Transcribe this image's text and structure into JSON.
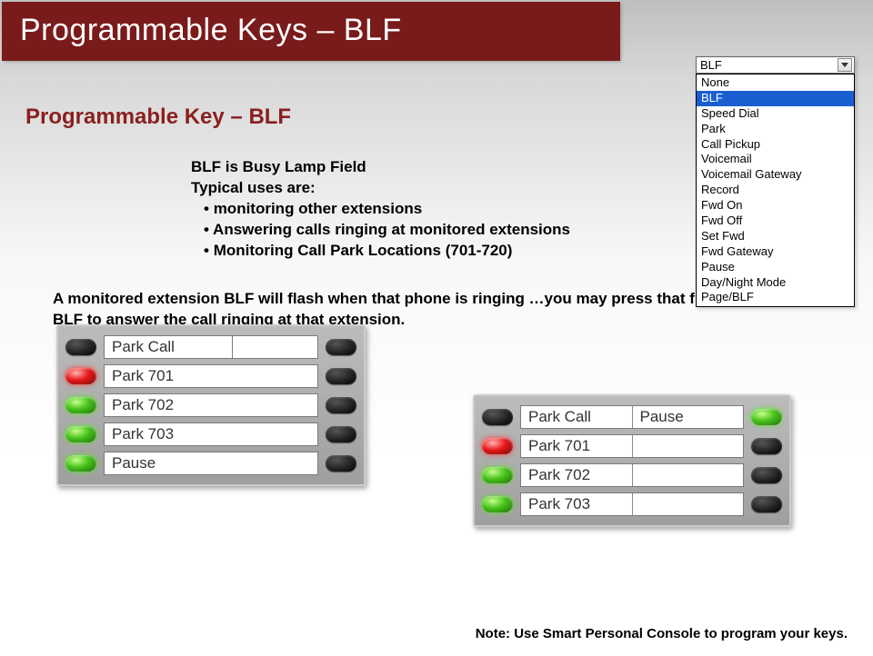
{
  "title": "Programmable Keys – BLF",
  "subtitle": "Programmable Key – BLF",
  "body": {
    "line1": "BLF is Busy Lamp Field",
    "line2": "Typical uses are:",
    "bullets": [
      "monitoring other extensions",
      "Answering calls ringing at monitored extensions",
      "Monitoring Call Park Locations (701-720)"
    ]
  },
  "dropdown": {
    "selected": "BLF",
    "options": [
      "None",
      "BLF",
      "Speed Dial",
      "Park",
      "Call Pickup",
      "Voicemail",
      "Voicemail Gateway",
      "Record",
      "Fwd On",
      "Fwd Off",
      "Set Fwd",
      "Fwd Gateway",
      "Pause",
      "Day/Night Mode",
      "Page/BLF"
    ],
    "highlighted_index": 1
  },
  "panel1": {
    "rows": [
      {
        "left_lamp": "dark",
        "label_left": "Park Call",
        "label_right": "",
        "right_lamp": "dark"
      },
      {
        "left_lamp": "red",
        "label": "Park 701",
        "right_lamp": "dark"
      },
      {
        "left_lamp": "green",
        "label": "Park 702",
        "right_lamp": "dark"
      },
      {
        "left_lamp": "green",
        "label": "Park 703",
        "right_lamp": "dark"
      },
      {
        "left_lamp": "green",
        "label": "Pause",
        "right_lamp": "dark"
      }
    ]
  },
  "panel2": {
    "rows": [
      {
        "left_lamp": "dark",
        "label_left": "Park Call",
        "label_right": "Pause",
        "right_lamp": "green"
      },
      {
        "left_lamp": "red",
        "label_left": "Park 701",
        "label_right": "",
        "right_lamp": "dark"
      },
      {
        "left_lamp": "green",
        "label_left": "Park 702",
        "label_right": "",
        "right_lamp": "dark"
      },
      {
        "left_lamp": "green",
        "label_left": "Park 703",
        "label_right": "",
        "right_lamp": "dark"
      }
    ]
  },
  "bottom_text": "A monitored extension BLF will flash when that phone is ringing …you may press that flashing BLF to answer the call ringing at that extension.",
  "note": "Note: Use Smart Personal Console to program your keys."
}
